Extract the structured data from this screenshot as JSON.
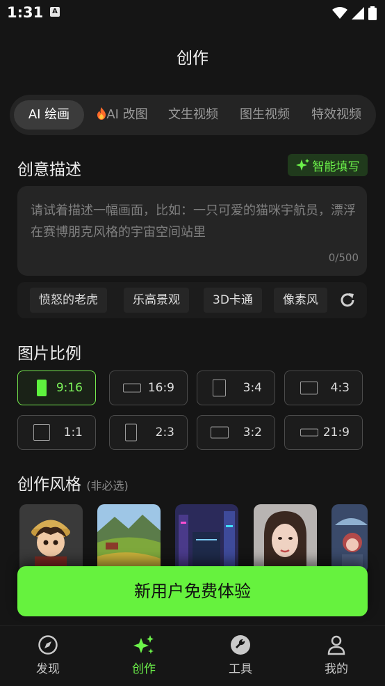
{
  "status": {
    "time": "1:31",
    "notification_icon": "A"
  },
  "header": {
    "title": "创作"
  },
  "tabs": [
    {
      "label": "AI 绘画",
      "active": true
    },
    {
      "label": "AI 改图",
      "icon": "fire-icon"
    },
    {
      "label": "文生视频"
    },
    {
      "label": "图生视频"
    },
    {
      "label": "特效视频"
    }
  ],
  "description": {
    "title": "创意描述",
    "smart_fill": "智能填写",
    "placeholder": "请试着描述一幅画面，比如：一只可爱的猫咪宇航员，漂浮在赛博朋克风格的宇宙空间站里",
    "counter": "0/500"
  },
  "suggestions": [
    "愤怒的老虎",
    "乐高景观",
    "3D卡通",
    "像素风"
  ],
  "ratio": {
    "title": "图片比例",
    "options": [
      "9:16",
      "16:9",
      "3:4",
      "4:3",
      "1:1",
      "2:3",
      "3:2",
      "21:9"
    ],
    "selected": "9:16"
  },
  "style": {
    "title": "创作风格",
    "subtitle": "(非必选)",
    "thumbnails": [
      "cartoon-boy",
      "landscape",
      "cyberpunk-city",
      "portrait-woman",
      "anime-rain"
    ]
  },
  "cta": {
    "label": "新用户免费体验"
  },
  "nav": [
    {
      "label": "发现",
      "icon": "compass-icon"
    },
    {
      "label": "创作",
      "icon": "sparkle-icon",
      "active": true
    },
    {
      "label": "工具",
      "icon": "wrench-icon"
    },
    {
      "label": "我的",
      "icon": "person-icon"
    }
  ],
  "colors": {
    "accent": "#66f23e",
    "background": "#151515"
  }
}
